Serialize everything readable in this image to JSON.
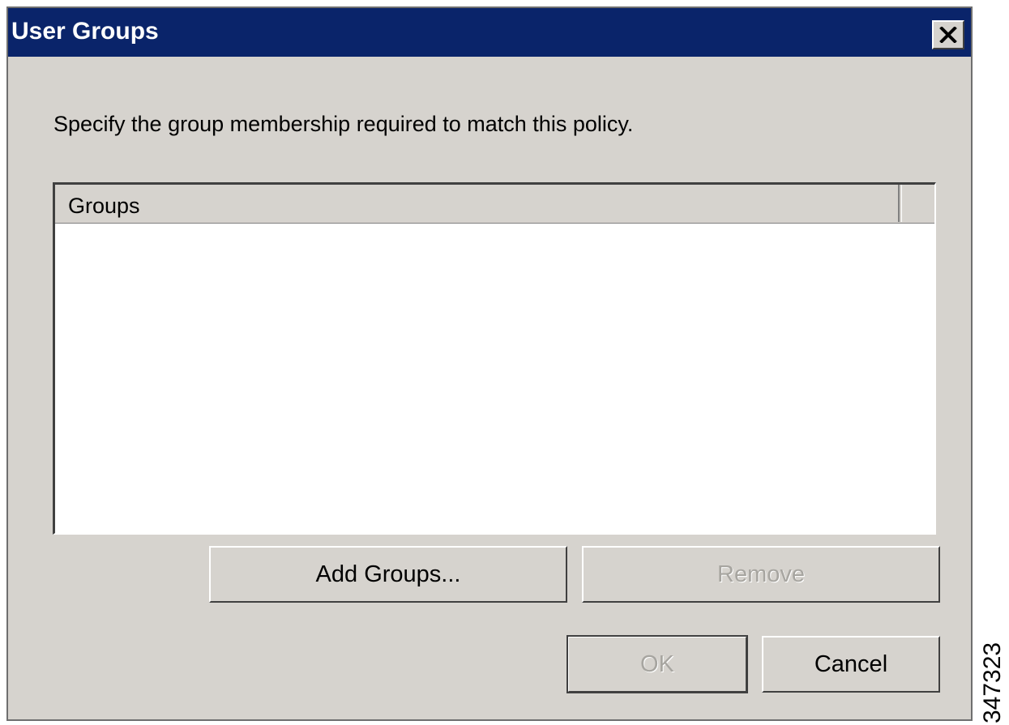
{
  "window": {
    "title": "User Groups",
    "close_icon": "close-icon",
    "title_bar_color": "#0a246a",
    "background_color": "#d6d3ce"
  },
  "instruction": "Specify the group membership required to match this policy.",
  "groups_list": {
    "columns": [
      "Groups"
    ],
    "rows": []
  },
  "buttons": {
    "add_groups": "Add Groups...",
    "remove": "Remove",
    "ok": "OK",
    "cancel": "Cancel"
  },
  "figure_id": "347323"
}
